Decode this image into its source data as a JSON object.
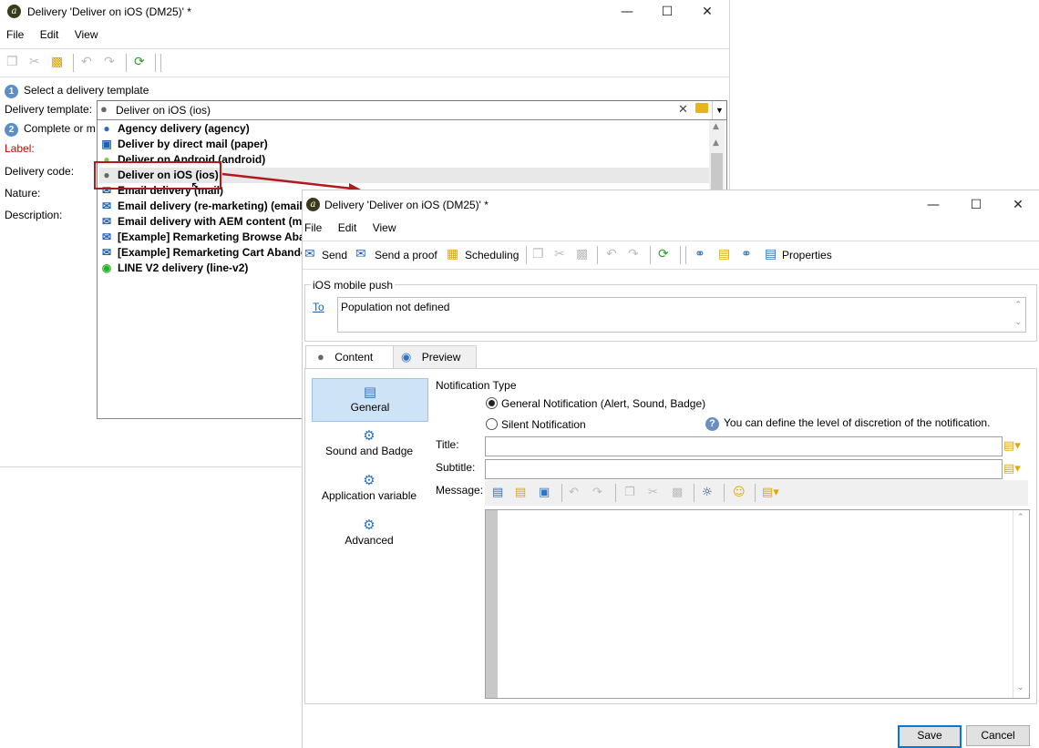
{
  "window1": {
    "title": "Delivery 'Deliver on iOS (DM25)' *",
    "menu": [
      "File",
      "Edit",
      "View"
    ],
    "step1": "Select a delivery template",
    "step1_num": "1",
    "template_label": "Delivery template:",
    "template_value": "Deliver on iOS (ios)",
    "step2": "Complete or m",
    "step2_num": "2",
    "label_field": "Label:",
    "delivery_code": "Delivery code:",
    "nature": "Nature:",
    "description": "Description:",
    "dropdown_items": [
      {
        "icon": "users-icon",
        "text": "Agency delivery (agency)"
      },
      {
        "icon": "direct-mail-icon",
        "text": "Deliver by direct mail (paper)"
      },
      {
        "icon": "android-icon",
        "text": "Deliver on Android (android)"
      },
      {
        "icon": "apple-icon",
        "text": "Deliver on iOS (ios)"
      },
      {
        "icon": "envelope-icon",
        "text": "Email delivery (mail)"
      },
      {
        "icon": "envelope-icon",
        "text": "Email delivery (re-marketing) (email"
      },
      {
        "icon": "envelope-icon",
        "text": "Email delivery with AEM content (ma"
      },
      {
        "icon": "envelope-icon",
        "text": "[Example] Remarketing Browse Aba"
      },
      {
        "icon": "envelope-icon",
        "text": "[Example] Remarketing Cart Abando"
      },
      {
        "icon": "line-icon",
        "text": "LINE V2 delivery (line-v2)"
      }
    ]
  },
  "window2": {
    "title": "Delivery 'Deliver on iOS (DM25)' *",
    "menu": [
      "File",
      "Edit",
      "View"
    ],
    "toolbar": {
      "send": "Send",
      "send_proof": "Send a proof",
      "scheduling": "Scheduling",
      "properties": "Properties"
    },
    "section_title": "iOS mobile push",
    "to_link": "To",
    "population": "Population not defined",
    "tabs": [
      "Content",
      "Preview"
    ],
    "side_items": [
      "General",
      "Sound and Badge",
      "Application variable",
      "Advanced"
    ],
    "notification_type_label": "Notification Type",
    "radio_general": "General Notification (Alert, Sound, Badge)",
    "radio_silent": "Silent Notification",
    "hint": "You can define the level of discretion of the notification.",
    "title_label": "Title:",
    "subtitle_label": "Subtitle:",
    "message_label": "Message:",
    "save": "Save",
    "cancel": "Cancel"
  },
  "colors": {
    "highlight_box": "#b0191e",
    "arrow": "#b0191e",
    "accent_blue": "#1e62b0",
    "selected_bg": "#cfe3f7"
  }
}
